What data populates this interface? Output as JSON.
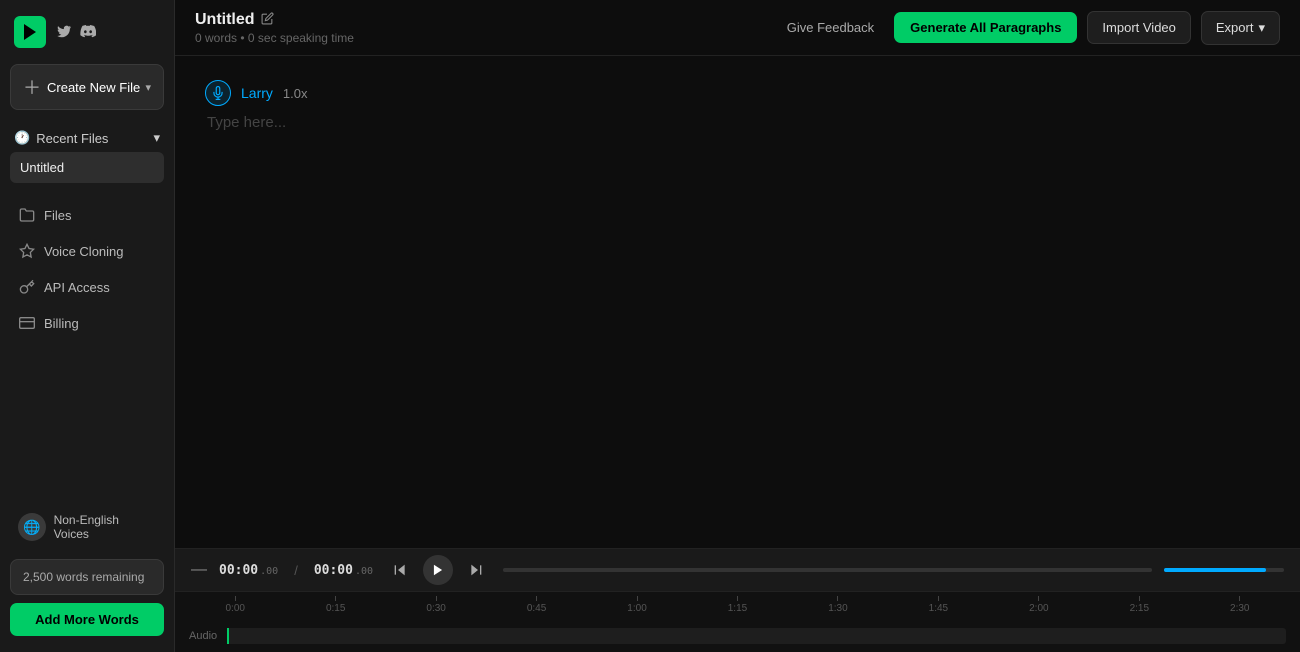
{
  "app": {
    "logo_text": "PLAYHT"
  },
  "sidebar": {
    "create_btn_label": "Create New File",
    "recent_section_label": "Recent Files",
    "recent_items": [
      {
        "label": "Untitled"
      }
    ],
    "nav_items": [
      {
        "label": "Files",
        "icon": "folder"
      },
      {
        "label": "Voice Cloning",
        "icon": "star"
      },
      {
        "label": "API Access",
        "icon": "key"
      },
      {
        "label": "Billing",
        "icon": "card"
      }
    ],
    "non_english_label": "Non-English Voices",
    "words_remaining_text": "2,500 words remaining",
    "add_words_label": "Add More Words"
  },
  "topbar": {
    "doc_title": "Untitled",
    "doc_meta": "0 words • 0 sec speaking time",
    "feedback_label": "Give Feedback",
    "generate_label": "Generate All Paragraphs",
    "import_label": "Import Video",
    "export_label": "Export"
  },
  "editor": {
    "voice_name": "Larry",
    "voice_speed": "1.0x",
    "placeholder": "Type here..."
  },
  "transport": {
    "time_current": "00:00",
    "time_current_sub": ".00",
    "time_total": "00:00",
    "time_total_sub": ".00"
  },
  "timeline": {
    "track_label": "Audio",
    "markers": [
      "0:00",
      "0:15",
      "0:30",
      "0:45",
      "1:00",
      "1:15",
      "1:30",
      "1:45",
      "2:00",
      "2:15",
      "2:30"
    ]
  }
}
